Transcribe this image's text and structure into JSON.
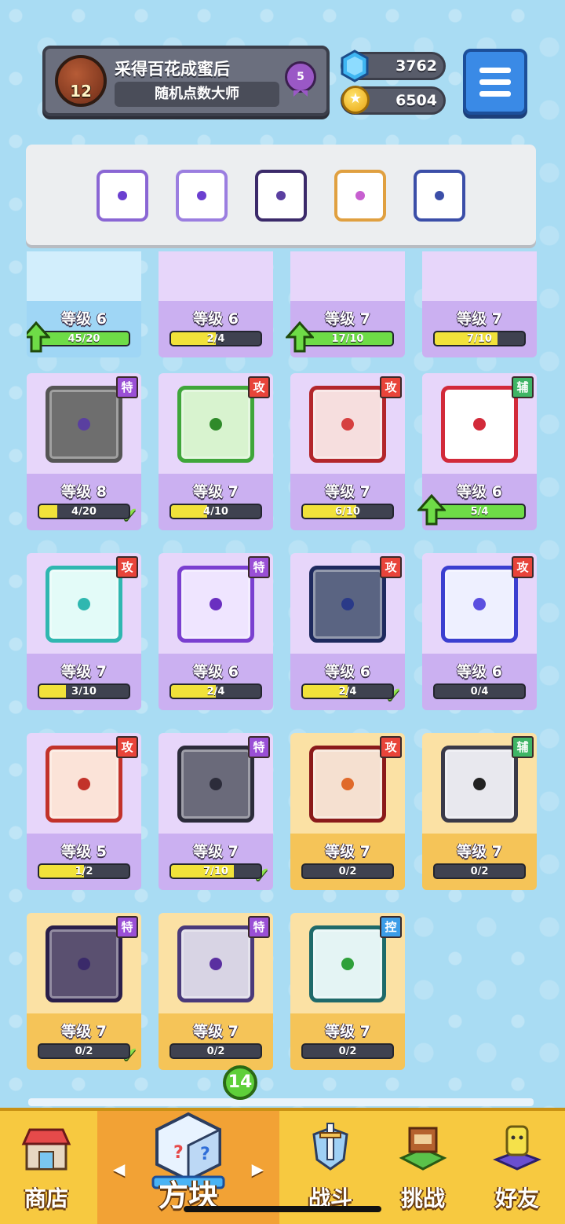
{
  "profile": {
    "level": "12",
    "title": "采得百花成蜜后",
    "subtitle": "随机点数大师",
    "rank": "5"
  },
  "currency": {
    "gems": "3762",
    "coins": "6504"
  },
  "deck": [
    {
      "name": "lightning-die",
      "border": "#8a66d4",
      "pip": "#6b3fd0"
    },
    {
      "name": "mystery-die",
      "border": "#9b7ee0",
      "pip": "#6b3fd0"
    },
    {
      "name": "dragon-lightning-die",
      "border": "#3b2a6a",
      "pip": "#5a3fa0"
    },
    {
      "name": "rainbow-die",
      "border": "#e0a040",
      "pip": "#c75fd0"
    },
    {
      "name": "gear-die",
      "border": "#3b4ea8",
      "pip": "#3b4ea8"
    }
  ],
  "row0": [
    {
      "lvl": "等级 6",
      "bar": "45/20",
      "fill": 1.0,
      "up": true,
      "style": "blue"
    },
    {
      "lvl": "等级 6",
      "bar": "2/4",
      "fill": 0.5,
      "up": false,
      "style": "purple"
    },
    {
      "lvl": "等级 7",
      "bar": "17/10",
      "fill": 1.0,
      "up": true,
      "style": "purple"
    },
    {
      "lvl": "等级 7",
      "bar": "7/10",
      "fill": 0.7,
      "up": false,
      "style": "purple"
    }
  ],
  "cards": [
    {
      "row": 1,
      "col": 0,
      "style": "purple",
      "tag": "特",
      "tagType": "spc",
      "lvl": "等级 8",
      "bar": "4/20",
      "fill": 0.2,
      "up": false,
      "check": true,
      "border": "#555",
      "face": "#6e6e6e",
      "pip": "#5a3fa0",
      "name": "rainbow-grey-die"
    },
    {
      "row": 1,
      "col": 1,
      "style": "purple",
      "tag": "攻",
      "tagType": "atk",
      "lvl": "等级 7",
      "bar": "4/10",
      "fill": 0.4,
      "up": false,
      "check": false,
      "border": "#3fa63a",
      "face": "#d8f3cf",
      "pip": "#2f8a2a",
      "name": "poison-die"
    },
    {
      "row": 1,
      "col": 2,
      "style": "purple",
      "tag": "攻",
      "tagType": "atk",
      "lvl": "等级 7",
      "bar": "6/10",
      "fill": 0.6,
      "up": false,
      "check": false,
      "border": "#b3262b",
      "face": "#f6dede",
      "pip": "#d64040",
      "name": "crack-die"
    },
    {
      "row": 1,
      "col": 3,
      "style": "purple",
      "tag": "辅",
      "tagType": "sup",
      "lvl": "等级 6",
      "bar": "5/4",
      "fill": 1.0,
      "up": true,
      "check": false,
      "border": "#d22a3a",
      "face": "#ffffff",
      "pip": "#d22a3a",
      "name": "crit-die"
    },
    {
      "row": 2,
      "col": 0,
      "style": "purple",
      "tag": "攻",
      "tagType": "atk",
      "lvl": "等级 7",
      "bar": "3/10",
      "fill": 0.3,
      "up": false,
      "check": false,
      "border": "#2fb7b0",
      "face": "#e3fbf8",
      "pip": "#2fb7b0",
      "name": "wind-die"
    },
    {
      "row": 2,
      "col": 1,
      "style": "purple",
      "tag": "特",
      "tagType": "spc",
      "lvl": "等级 6",
      "bar": "2/4",
      "fill": 0.5,
      "up": false,
      "check": false,
      "border": "#7a3fd0",
      "face": "#efe5ff",
      "pip": "#6a2fc0",
      "name": "teleport-die"
    },
    {
      "row": 2,
      "col": 2,
      "style": "purple",
      "tag": "攻",
      "tagType": "atk",
      "lvl": "等级 6",
      "bar": "2/4",
      "fill": 0.5,
      "up": false,
      "check": true,
      "border": "#1e2a5e",
      "face": "#5a6482",
      "pip": "#2a3a88",
      "name": "gear-die"
    },
    {
      "row": 2,
      "col": 3,
      "style": "purple",
      "tag": "攻",
      "tagType": "atk",
      "lvl": "等级 6",
      "bar": "0/4",
      "fill": 0,
      "up": false,
      "check": false,
      "border": "#3b3fd0",
      "face": "#eef0ff",
      "pip": "#5a4fe0",
      "name": "orb-die"
    },
    {
      "row": 3,
      "col": 0,
      "style": "purple",
      "tag": "攻",
      "tagType": "atk",
      "lvl": "等级 5",
      "bar": "1/2",
      "fill": 0.5,
      "up": false,
      "check": false,
      "border": "#c2322a",
      "face": "#fbe3d8",
      "pip": "#c2322a",
      "name": "fire-die"
    },
    {
      "row": 3,
      "col": 1,
      "style": "purple",
      "tag": "特",
      "tagType": "spc",
      "lvl": "等级 7",
      "bar": "7/10",
      "fill": 0.7,
      "up": false,
      "check": true,
      "border": "#2c2c3a",
      "face": "#6a6a7a",
      "pip": "#2c2c3a",
      "name": "dark-lightning-die"
    },
    {
      "row": 3,
      "col": 2,
      "style": "gold",
      "tag": "攻",
      "tagType": "atk",
      "lvl": "等级 7",
      "bar": "0/2",
      "fill": 0,
      "up": false,
      "check": false,
      "border": "#8a1a1a",
      "face": "#f5e0d0",
      "pip": "#e06a2a",
      "name": "dragon-sun-die"
    },
    {
      "row": 3,
      "col": 3,
      "style": "gold",
      "tag": "辅",
      "tagType": "sup",
      "lvl": "等级 7",
      "bar": "0/2",
      "fill": 0,
      "up": false,
      "check": false,
      "border": "#3a3a48",
      "face": "#e8e8ee",
      "pip": "#222",
      "name": "dragon-beast-die"
    },
    {
      "row": 4,
      "col": 0,
      "style": "gold",
      "tag": "特",
      "tagType": "spc",
      "lvl": "等级 7",
      "bar": "0/2",
      "fill": 0,
      "up": false,
      "check": true,
      "border": "#2a1f4a",
      "face": "#5a5070",
      "pip": "#3a2a6a",
      "name": "dragon-dark-die"
    },
    {
      "row": 4,
      "col": 1,
      "style": "gold",
      "tag": "特",
      "tagType": "spc",
      "lvl": "等级 7",
      "bar": "0/2",
      "fill": 0,
      "up": false,
      "check": false,
      "border": "#4a3a7a",
      "face": "#d8d4e4",
      "pip": "#5a2fa0",
      "name": "dragon-void-die"
    },
    {
      "row": 4,
      "col": 2,
      "style": "gold",
      "tag": "控",
      "tagType": "ctl",
      "lvl": "等级 7",
      "bar": "0/2",
      "fill": 0,
      "up": false,
      "check": false,
      "border": "#1f6a6a",
      "face": "#e4f4f4",
      "pip": "#2fa03a",
      "name": "dragon-wind-die"
    }
  ],
  "nav": {
    "badge": "14",
    "items": [
      {
        "label": "商店",
        "name": "shop"
      },
      {
        "label": "方块",
        "name": "dice"
      },
      {
        "label": "战斗",
        "name": "battle"
      },
      {
        "label": "挑战",
        "name": "challenge"
      },
      {
        "label": "好友",
        "name": "friends"
      }
    ]
  },
  "colors": {
    "accent": "#3a8ae6",
    "nav": "#f7c940",
    "active_nav": "#f2a235"
  }
}
